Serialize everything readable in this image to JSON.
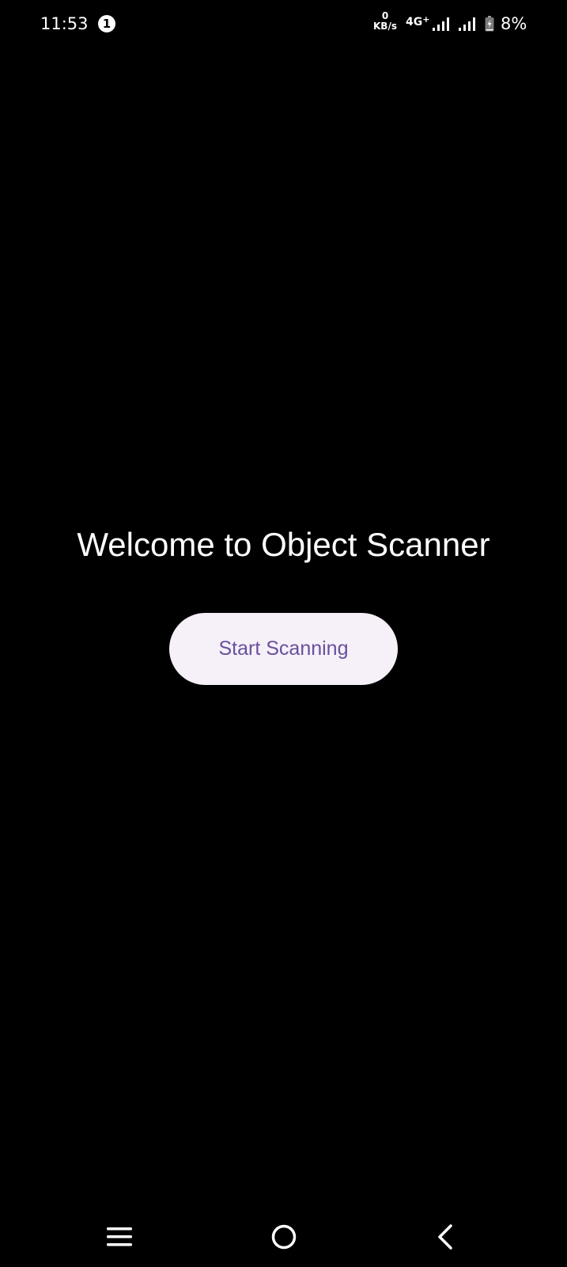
{
  "status_bar": {
    "time": "11:53",
    "notification_count": "1",
    "net_speed_value": "0",
    "net_speed_unit": "KB/s",
    "network_type": "4G",
    "network_type_suffix": "+",
    "battery_percent": "8%",
    "icons": [
      "notification-badge",
      "signal-bars-icon",
      "signal-bars-icon",
      "battery-charging-icon"
    ]
  },
  "main": {
    "title": "Welcome to Object Scanner",
    "start_button_label": "Start Scanning"
  },
  "nav_bar": {
    "icons": [
      "menu-icon",
      "home-icon",
      "back-icon"
    ]
  },
  "colors": {
    "background": "#000000",
    "text": "#ffffff",
    "button_background": "#f6f0f9",
    "button_text": "#6a4f9c"
  }
}
